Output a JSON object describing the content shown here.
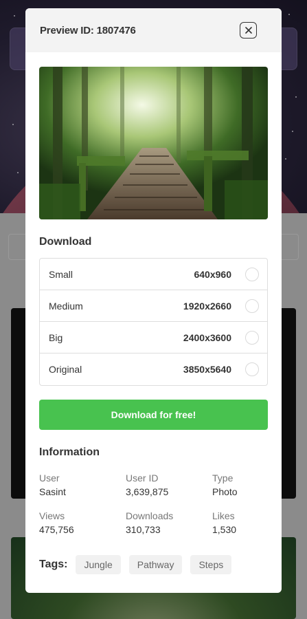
{
  "modal": {
    "title": "Preview ID: 1807476",
    "close_icon": "close-icon",
    "preview_alt": "forest wooden stairs pathway"
  },
  "download": {
    "title": "Download",
    "sizes": [
      {
        "name": "Small",
        "dimensions": "640x960"
      },
      {
        "name": "Medium",
        "dimensions": "1920x2660"
      },
      {
        "name": "Big",
        "dimensions": "2400x3600"
      },
      {
        "name": "Original",
        "dimensions": "3850x5640"
      }
    ],
    "button_label": "Download for free!"
  },
  "information": {
    "title": "Information",
    "items": [
      {
        "label": "User",
        "value": "Sasint"
      },
      {
        "label": "User ID",
        "value": "3,639,875"
      },
      {
        "label": "Type",
        "value": "Photo"
      },
      {
        "label": "Views",
        "value": "475,756"
      },
      {
        "label": "Downloads",
        "value": "310,733"
      },
      {
        "label": "Likes",
        "value": "1,530"
      }
    ]
  },
  "tags": {
    "label": "Tags:",
    "items": [
      "Jungle",
      "Pathway",
      "Steps"
    ]
  },
  "colors": {
    "accent_green": "#48c24f",
    "header_bg": "#f3f3f3",
    "text_dark": "#333333"
  }
}
